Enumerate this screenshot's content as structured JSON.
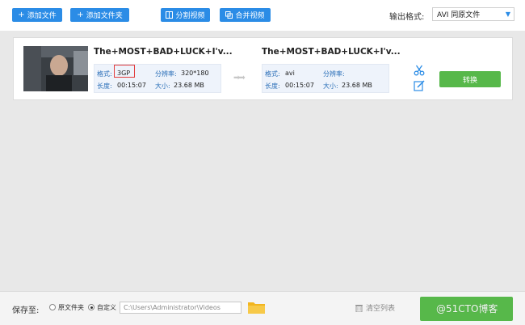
{
  "toolbar": {
    "add_file": "添加文件",
    "add_folder": "添加文件夹",
    "split_video": "分割视频",
    "merge_video": "合并视频",
    "output_label": "输出格式:",
    "output_value": "AVI  同原文件"
  },
  "file": {
    "source": {
      "name": "The+MOST+BAD+LUCK+I'v...",
      "format_label": "格式:",
      "format": "3GP",
      "resolution_label": "分辨率:",
      "resolution": "320*180",
      "duration_label": "长度:",
      "duration": "00:15:07",
      "size_label": "大小:",
      "size": "23.68 MB"
    },
    "target": {
      "name": "The+MOST+BAD+LUCK+I'v...",
      "format_label": "格式:",
      "format": "avi",
      "resolution_label": "分辨率:",
      "resolution": "",
      "duration_label": "长度:",
      "duration": "00:15:07",
      "size_label": "大小:",
      "size": "23.68 MB"
    },
    "convert_label": "转换"
  },
  "bottom": {
    "save_label": "保存至:",
    "option_source": "原文件夹",
    "option_custom": "自定义",
    "path": "C:\\Users\\Administrator\\Videos",
    "clear_label": "清空列表",
    "watermark": "@51CTO博客"
  },
  "colors": {
    "accent": "#2b8ce6",
    "convert": "#57b84a",
    "highlight": "#e23b3b"
  }
}
